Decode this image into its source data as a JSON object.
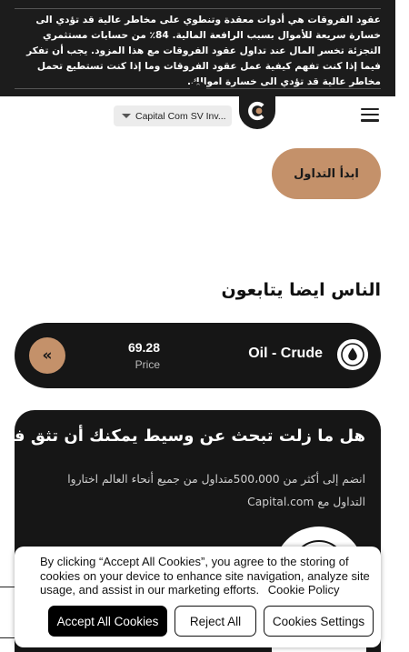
{
  "risk_banner": {
    "text": "عقود الفروقات هي أدوات معقدة وتنطوي على مخاطر عالية قد تؤدي الى خسارة سريعة للأموال بسبب الرافعة المالية. 84٪ من حسابات مستثمري التجزئة تخسر المال عند تداول عقود الفروقات مع هذا المزود. يجب أن تفكر فيما إذا كنت تفهم كيفية عمل عقود الفروقات وما إذا كنت تستطيع تحمل مخاطر عالية قد تؤدي الى خسارة اموالك.",
    "collapse_icon": "double-chevron-up-icon"
  },
  "header": {
    "entity_select": "Capital Com SV Inv...",
    "logo_icon": "capital-com-logo",
    "menu_icon": "hamburger-menu-icon"
  },
  "hero": {
    "start_trading_label": "ابدأ التداول"
  },
  "people_also_follow": {
    "title": "الناس ايضا يتابعون",
    "instrument": {
      "name": "Oil - Crude",
      "price": "69.28",
      "price_label": "Price",
      "icon": "oil-drop-icon",
      "nav_icon": "double-chevron-left-icon"
    }
  },
  "broker_card": {
    "title": "هل ما زلت تبحث عن وسيط يمكنك أن تثق فيه؟",
    "description": "انضم إلى أكثر من 500،000متداول من جميع أنحاء العالم اختاروا التداول مع Capital.com"
  },
  "cookie_banner": {
    "text": "By clicking “Accept All Cookies”, you agree to the storing of cookies on your device to enhance site navigation, analyze site usage, and assist in our marketing efforts.",
    "policy_link": "Cookie Policy",
    "accept_label": "Accept All Cookies",
    "reject_label": "Reject All",
    "settings_label": "Cookies Settings"
  },
  "colors": {
    "dark": "#161616",
    "accent": "#c4916a",
    "banner": "#1c1c1c"
  }
}
